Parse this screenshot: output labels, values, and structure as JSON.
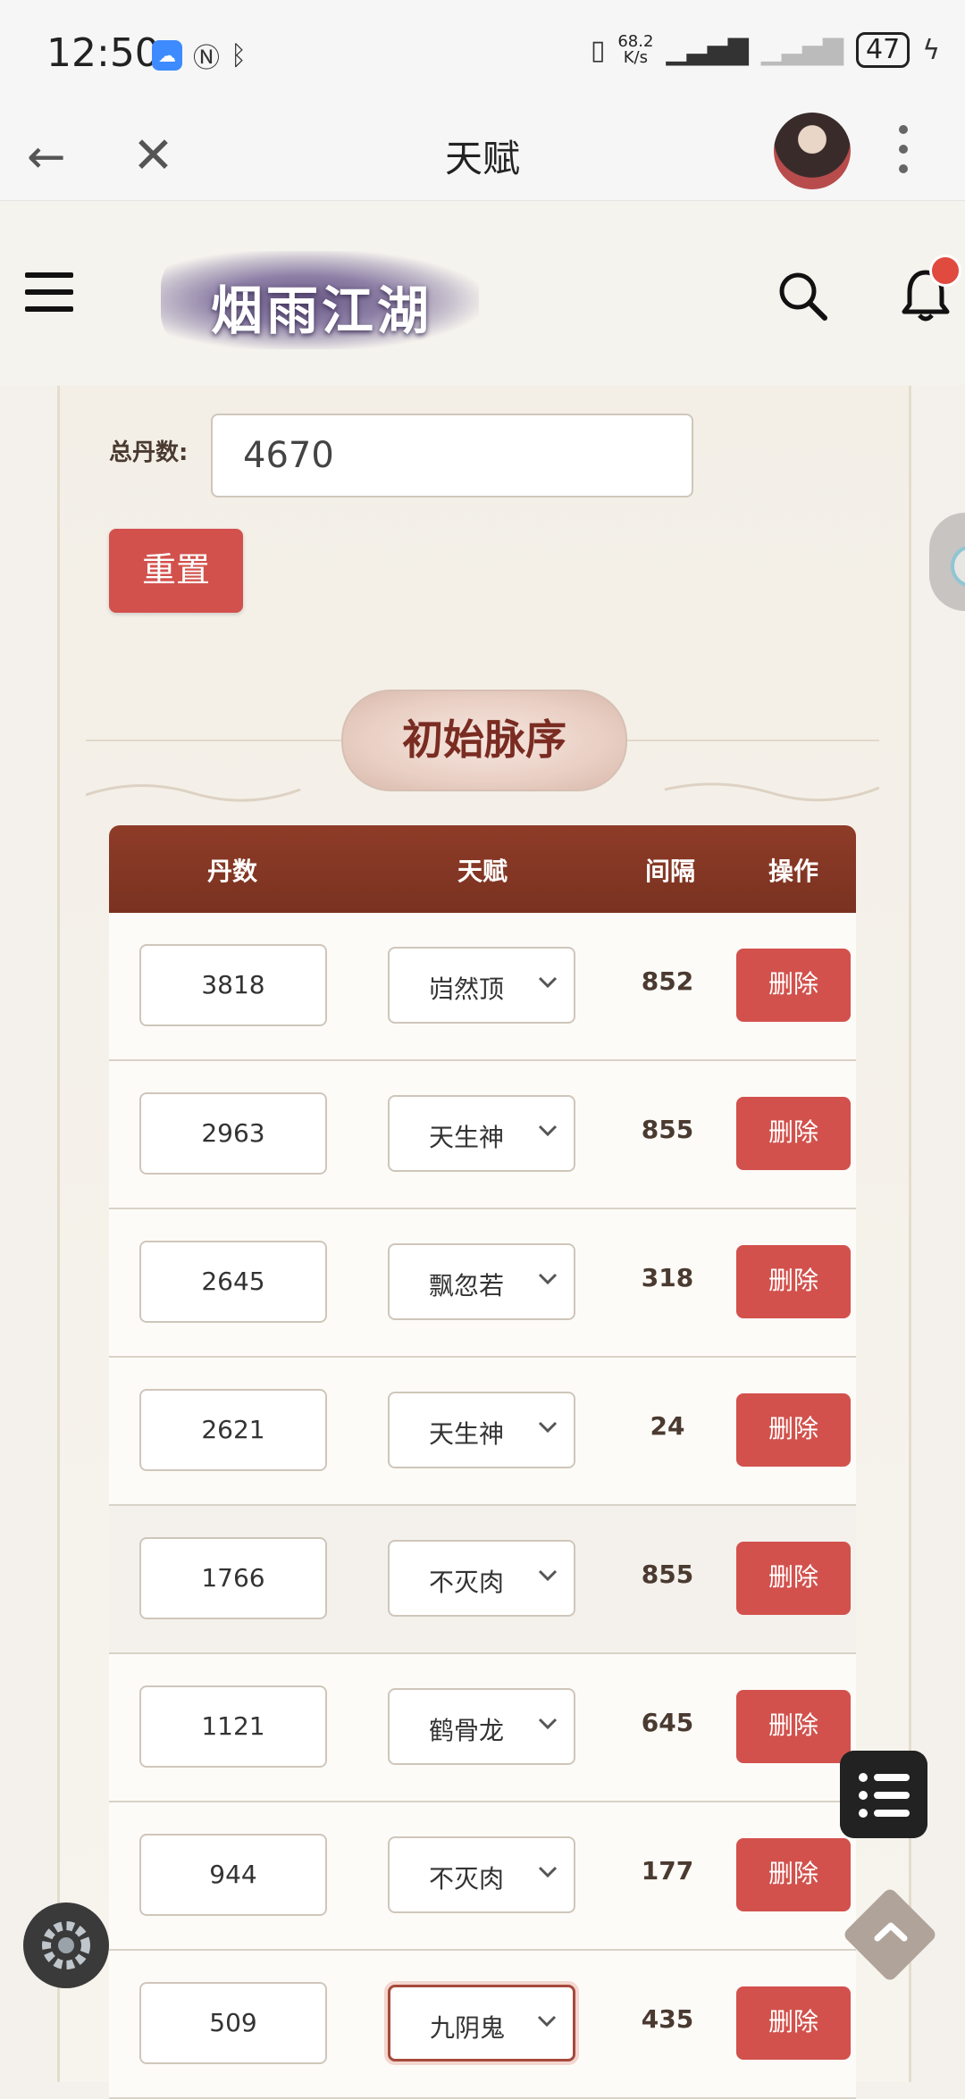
{
  "status_bar": {
    "time": "12:50",
    "net_speed_value": "68.2",
    "net_speed_unit": "K/s",
    "battery": "47"
  },
  "nav": {
    "title": "天赋"
  },
  "site": {
    "logo_text": "烟雨江湖"
  },
  "form": {
    "total_label": "总丹数:",
    "total_value": "4670",
    "reset_label": "重置"
  },
  "section": {
    "title": "初始脉序"
  },
  "table": {
    "headers": [
      "丹数",
      "天赋",
      "间隔",
      "操作"
    ],
    "rows": [
      {
        "dan": "3818",
        "talent": "岿然顶",
        "gap": "852",
        "action": "删除"
      },
      {
        "dan": "2963",
        "talent": "天生神",
        "gap": "855",
        "action": "删除"
      },
      {
        "dan": "2645",
        "talent": "飘忽若",
        "gap": "318",
        "action": "删除"
      },
      {
        "dan": "2621",
        "talent": "天生神",
        "gap": "24",
        "action": "删除"
      },
      {
        "dan": "1766",
        "talent": "不灭肉",
        "gap": "855",
        "action": "删除"
      },
      {
        "dan": "1121",
        "talent": "鹤骨龙",
        "gap": "645",
        "action": "删除"
      },
      {
        "dan": "944",
        "talent": "不灭肉",
        "gap": "177",
        "action": "删除"
      },
      {
        "dan": "509",
        "talent": "九阴鬼",
        "gap": "435",
        "action": "删除"
      }
    ]
  },
  "colors": {
    "accent_red": "#d2514c",
    "header_brown": "#8e3c28",
    "title_text": "#7a2c22"
  }
}
